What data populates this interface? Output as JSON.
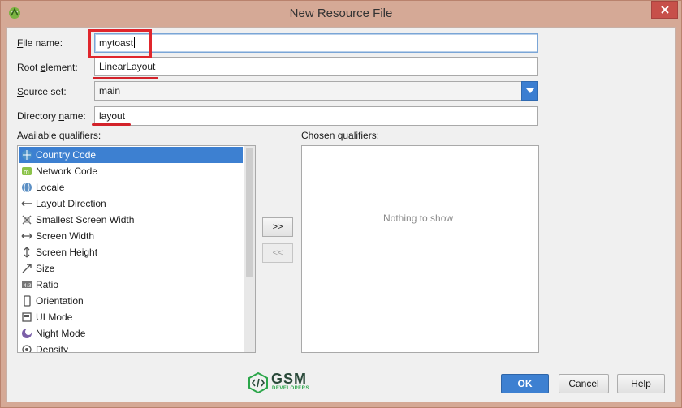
{
  "window": {
    "title": "New Resource File",
    "accent_color": "#3d80d1",
    "annotation_color": "#e0262c"
  },
  "form": {
    "file_name_label_u": "F",
    "file_name_label_rest": "ile name:",
    "file_name_value": "mytoast",
    "root_element_label_a": "Root ",
    "root_element_label_u": "e",
    "root_element_label_b": "lement:",
    "root_element_value": "LinearLayout",
    "source_set_label_u": "S",
    "source_set_label_rest": "ource set:",
    "source_set_value": "main",
    "directory_label_a": "Directory ",
    "directory_label_u": "n",
    "directory_label_b": "ame:",
    "directory_value": "layout"
  },
  "available": {
    "label_u": "A",
    "label_rest": "vailable qualifiers:",
    "items": [
      {
        "label": "Country Code",
        "icon": "country-code-icon",
        "selected": true
      },
      {
        "label": "Network Code",
        "icon": "network-code-icon"
      },
      {
        "label": "Locale",
        "icon": "globe-icon"
      },
      {
        "label": "Layout Direction",
        "icon": "layout-direction-icon"
      },
      {
        "label": "Smallest Screen Width",
        "icon": "smallest-width-icon"
      },
      {
        "label": "Screen Width",
        "icon": "screen-width-icon"
      },
      {
        "label": "Screen Height",
        "icon": "screen-height-icon"
      },
      {
        "label": "Size",
        "icon": "size-icon"
      },
      {
        "label": "Ratio",
        "icon": "ratio-icon"
      },
      {
        "label": "Orientation",
        "icon": "orientation-icon"
      },
      {
        "label": "UI Mode",
        "icon": "ui-mode-icon"
      },
      {
        "label": "Night Mode",
        "icon": "night-mode-icon"
      },
      {
        "label": "Density",
        "icon": "density-icon"
      }
    ]
  },
  "chosen": {
    "label_u": "C",
    "label_rest": "hosen qualifiers:",
    "empty_text": "Nothing to show"
  },
  "transfer": {
    "add_label": ">>",
    "remove_label": "<<"
  },
  "buttons": {
    "ok": "OK",
    "cancel": "Cancel",
    "help": "Help"
  },
  "logo": {
    "name": "GSM",
    "sub": "DEVELOPERS"
  }
}
